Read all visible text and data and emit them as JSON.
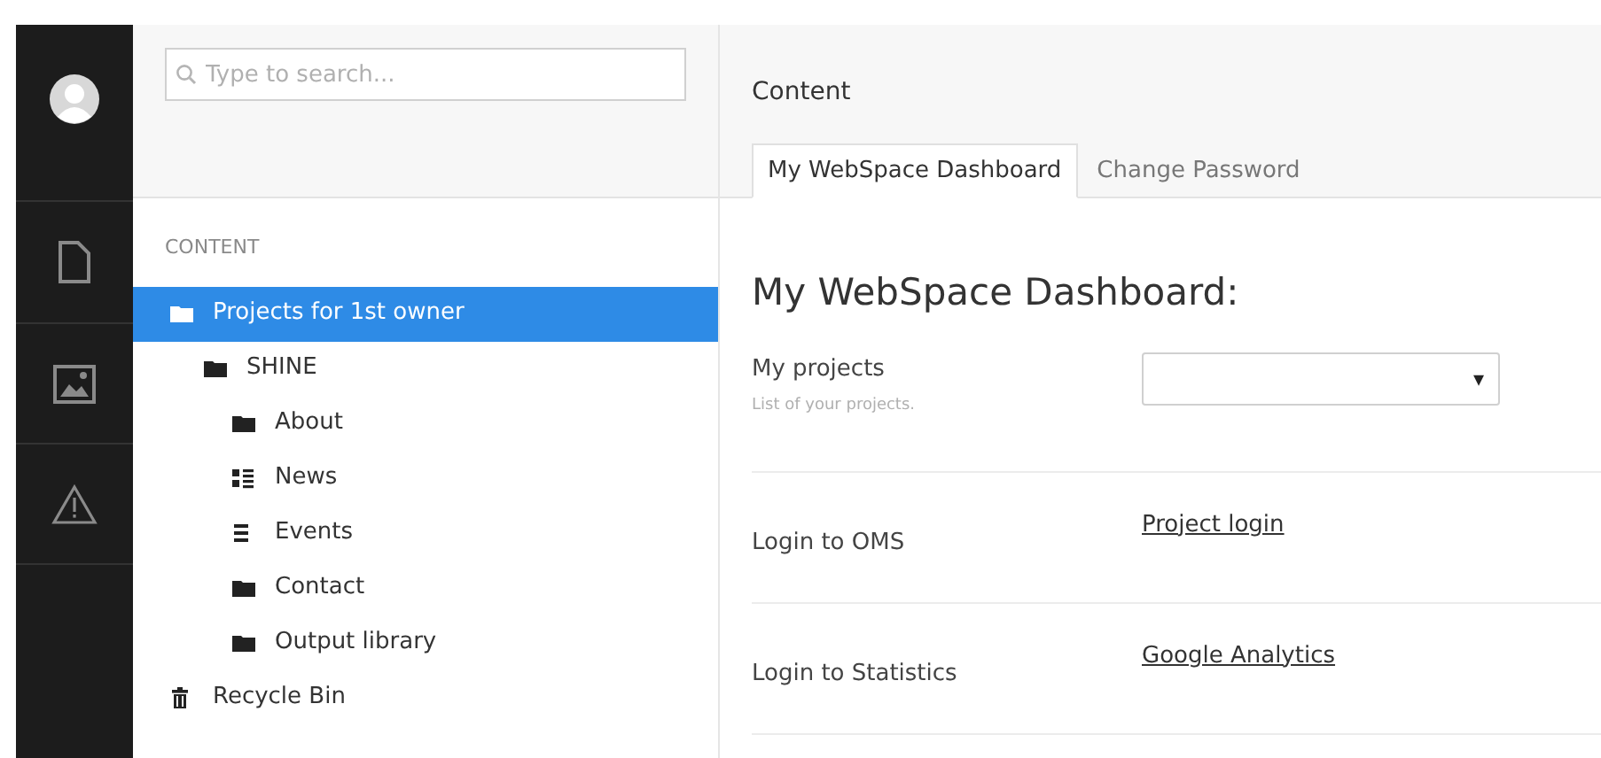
{
  "search": {
    "placeholder": "Type to search..."
  },
  "sidebar": {
    "heading": "CONTENT",
    "tree": [
      {
        "label": "Projects for 1st owner",
        "kind": "folder",
        "selected": true,
        "children": [
          {
            "label": "SHINE",
            "kind": "folder",
            "selected": false,
            "children": [
              {
                "label": "About",
                "kind": "folder",
                "selected": false
              },
              {
                "label": "News",
                "kind": "grid",
                "selected": false
              },
              {
                "label": "Events",
                "kind": "list",
                "selected": false
              },
              {
                "label": "Contact",
                "kind": "folder",
                "selected": false
              },
              {
                "label": "Output library",
                "kind": "folder",
                "selected": false
              }
            ]
          }
        ]
      },
      {
        "label": "Recycle Bin",
        "kind": "trash",
        "selected": false
      }
    ]
  },
  "header": {
    "title": "Content"
  },
  "tabs": [
    {
      "label": "My WebSpace Dashboard",
      "selected": true
    },
    {
      "label": "Change Password",
      "selected": false
    }
  ],
  "dashboard": {
    "heading": "My WebSpace Dashboard:",
    "rows": [
      {
        "kind": "select",
        "label": "My projects",
        "hint": "List of your projects.",
        "caret": "▾"
      },
      {
        "kind": "link",
        "label": "Login to OMS",
        "link": "Project login"
      },
      {
        "kind": "link",
        "label": "Login to Statistics",
        "link": "Google Analytics"
      }
    ]
  }
}
